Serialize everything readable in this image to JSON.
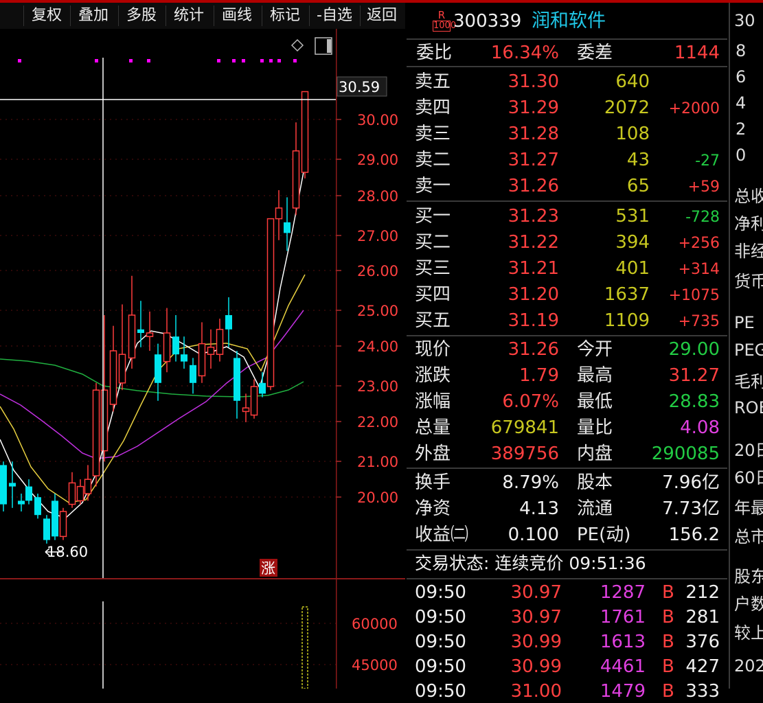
{
  "toolbar": {
    "buttons": [
      "复权",
      "叠加",
      "多股",
      "统计",
      "画线",
      "标记",
      "-自选",
      "返回"
    ]
  },
  "chart": {
    "price_labels": [
      "30.00",
      "29.00",
      "28.00",
      "27.00",
      "26.00",
      "25.00",
      "24.00",
      "23.00",
      "22.00",
      "21.00",
      "20.00"
    ],
    "cursor_price": "30.59",
    "low_marker": "18.60",
    "zhang_label": "涨",
    "volume_labels": [
      "60000",
      "45000"
    ],
    "colors": {
      "up": "#ff3c3c",
      "down": "#00e5ee",
      "ma5": "#ffffff",
      "ma10": "#e8d040",
      "ma20": "#c030e0",
      "ma60": "#20b040"
    }
  },
  "quote": {
    "r_badge": "R",
    "code_sub": "1000",
    "code": "300339",
    "name": "润和软件",
    "wb_label": "委比",
    "wb_value": "16.34%",
    "wc_label": "委差",
    "wc_value": "1144",
    "asks": [
      {
        "label": "卖五",
        "price": "31.30",
        "vol": "640",
        "chg": ""
      },
      {
        "label": "卖四",
        "price": "31.29",
        "vol": "2072",
        "chg": "+2000"
      },
      {
        "label": "卖三",
        "price": "31.28",
        "vol": "108",
        "chg": ""
      },
      {
        "label": "卖二",
        "price": "31.27",
        "vol": "43",
        "chg": "-27"
      },
      {
        "label": "卖一",
        "price": "31.26",
        "vol": "65",
        "chg": "+59"
      }
    ],
    "bids": [
      {
        "label": "买一",
        "price": "31.23",
        "vol": "531",
        "chg": "-728"
      },
      {
        "label": "买二",
        "price": "31.22",
        "vol": "394",
        "chg": "+256"
      },
      {
        "label": "买三",
        "price": "31.21",
        "vol": "401",
        "chg": "+314"
      },
      {
        "label": "买四",
        "price": "31.20",
        "vol": "1637",
        "chg": "+1075"
      },
      {
        "label": "买五",
        "price": "31.19",
        "vol": "1109",
        "chg": "+735"
      }
    ],
    "stats": [
      {
        "l1": "现价",
        "v1": "31.26",
        "l2": "今开",
        "v2": "29.00"
      },
      {
        "l1": "涨跌",
        "v1": "1.79",
        "l2": "最高",
        "v2": "31.27"
      },
      {
        "l1": "涨幅",
        "v1": "6.07%",
        "l2": "最低",
        "v2": "28.83"
      },
      {
        "l1": "总量",
        "v1": "679841",
        "l2": "量比",
        "v2": "4.08"
      },
      {
        "l1": "外盘",
        "v1": "389756",
        "l2": "内盘",
        "v2": "290085"
      }
    ],
    "fund": [
      {
        "l1": "换手",
        "v1": "8.79%",
        "l2": "股本",
        "v2": "7.96亿"
      },
      {
        "l1": "净资",
        "v1": "4.13",
        "l2": "流通",
        "v2": "7.73亿"
      },
      {
        "l1": "收益㈡",
        "v1": "0.100",
        "l2": "PE(动)",
        "v2": "156.2"
      }
    ],
    "status": "交易状态: 连续竞价 09:51:36",
    "ticks": [
      {
        "time": "09:50",
        "price": "30.97",
        "vol": "1287",
        "side": "B",
        "n": "212"
      },
      {
        "time": "09:50",
        "price": "30.97",
        "vol": "1761",
        "side": "B",
        "n": "281"
      },
      {
        "time": "09:50",
        "price": "30.99",
        "vol": "1613",
        "side": "B",
        "n": "376"
      },
      {
        "time": "09:50",
        "price": "30.99",
        "vol": "4461",
        "side": "B",
        "n": "427"
      },
      {
        "time": "09:50",
        "price": "31.00",
        "vol": "1479",
        "side": "B",
        "n": "333"
      }
    ]
  },
  "side_panel": {
    "header": "30",
    "digits": [
      "8",
      "6",
      "4",
      "2",
      "0"
    ],
    "items": [
      "总收",
      "净利",
      "非经",
      "货币",
      "PE",
      "PEG",
      "毛利",
      "ROE",
      "20日",
      "60日",
      "年最",
      "总市",
      "股东",
      "户数",
      "较上",
      "202"
    ]
  }
}
